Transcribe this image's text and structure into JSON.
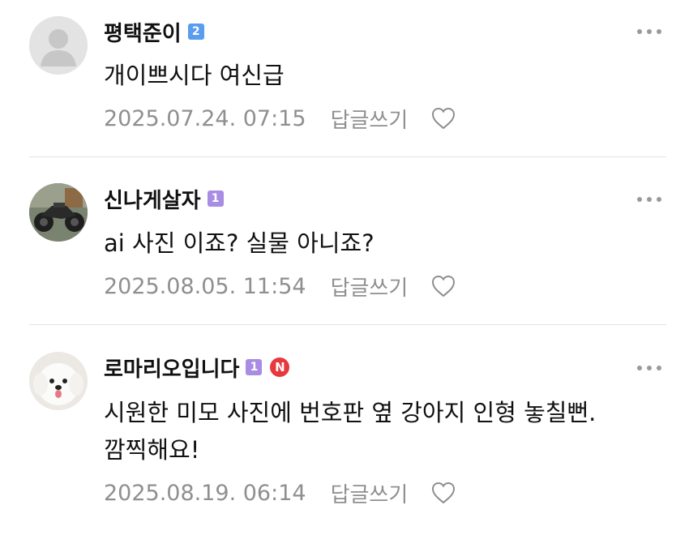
{
  "comments": [
    {
      "nickname": "평택준이",
      "level": "2",
      "text_lines": [
        "개이쁘시다 여신급"
      ],
      "timestamp": "2025.07.24. 07:15",
      "reply_label": "답글쓰기",
      "avatar_icon": "default-profile-silhouette-icon"
    },
    {
      "nickname": "신나게살자",
      "level": "1",
      "text_lines": [
        "ai 사진 이죠? 실물 아니죠?"
      ],
      "timestamp": "2025.08.05. 11:54",
      "reply_label": "답글쓰기",
      "avatar_icon": "motorcycle-photo-icon"
    },
    {
      "nickname": "로마리오입니다",
      "level": "1",
      "badge": "N",
      "text_lines": [
        "시원한 미모 사진에 번호판 옆 강아지 인형 놓칠뻔.",
        "깜찍해요!"
      ],
      "timestamp": "2025.08.19. 06:14",
      "reply_label": "답글쓰기",
      "avatar_icon": "white-puppy-photo-icon"
    }
  ],
  "colors": {
    "level2_badge": "#5a9cf0",
    "level1_badge": "#a98ce4",
    "new_badge": "#e8383d",
    "meta_text": "#8f8f8f",
    "divider": "#e4e4e4"
  }
}
